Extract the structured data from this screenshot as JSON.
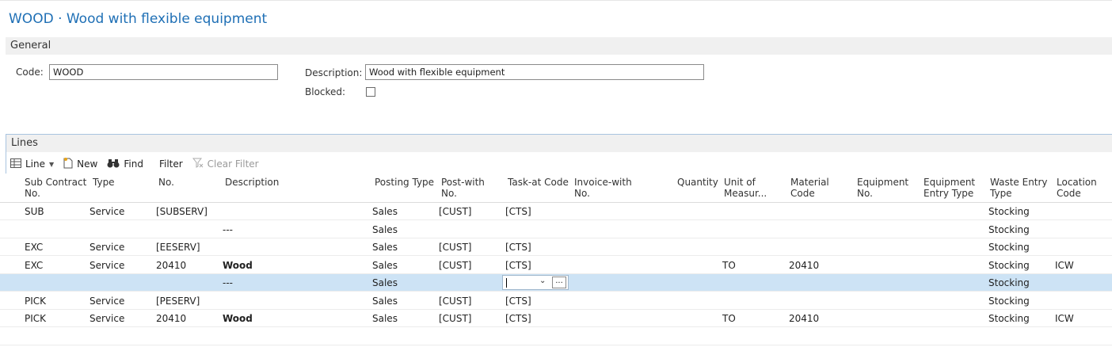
{
  "page": {
    "title": "WOOD · Wood with flexible equipment"
  },
  "general": {
    "section_label": "General",
    "code_label": "Code:",
    "code_value": "WOOD",
    "description_label": "Description:",
    "description_value": "Wood with flexible equipment",
    "blocked_label": "Blocked:",
    "blocked_checked": false
  },
  "lines": {
    "section_label": "Lines",
    "toolbar": {
      "line": "Line",
      "new": "New",
      "find": "Find",
      "filter": "Filter",
      "clear_filter": "Clear Filter"
    },
    "columns": [
      [
        "Sub Contract",
        "No."
      ],
      [
        "Type",
        ""
      ],
      [
        "No.",
        ""
      ],
      [
        "Description",
        ""
      ],
      [
        "Posting Type",
        ""
      ],
      [
        "Post-with",
        "No."
      ],
      [
        "Task-at Code",
        ""
      ],
      [
        "Invoice-with",
        "No."
      ],
      [
        "Quantity",
        ""
      ],
      [
        "Unit of",
        "Measur..."
      ],
      [
        "Material",
        "Code"
      ],
      [
        "Equipment",
        "No."
      ],
      [
        "Equipment",
        "Entry Type"
      ],
      [
        "Waste Entry",
        "Type"
      ],
      [
        "Location",
        "Code"
      ]
    ],
    "rows": [
      [
        "SUB",
        "Service",
        "[SUBSERV]",
        "",
        "Sales",
        "[CUST]",
        "[CTS]",
        "",
        "",
        "",
        "",
        "",
        "",
        "Stocking",
        ""
      ],
      [
        "",
        "",
        "",
        "---",
        "Sales",
        "",
        "",
        "",
        "",
        "",
        "",
        "",
        "",
        "Stocking",
        ""
      ],
      [
        "EXC",
        "Service",
        "[EESERV]",
        "",
        "Sales",
        "[CUST]",
        "[CTS]",
        "",
        "",
        "",
        "",
        "",
        "",
        "Stocking",
        ""
      ],
      [
        "EXC",
        "Service",
        "20410",
        "Wood",
        "Sales",
        "[CUST]",
        "[CTS]",
        "",
        "",
        "TO",
        "20410",
        "",
        "",
        "Stocking",
        "ICW"
      ],
      [
        "",
        "",
        "",
        "---",
        "Sales",
        "",
        "",
        "",
        "",
        "",
        "",
        "",
        "",
        "Stocking",
        ""
      ],
      [
        "PICK",
        "Service",
        "[PESERV]",
        "",
        "Sales",
        "[CUST]",
        "[CTS]",
        "",
        "",
        "",
        "",
        "",
        "",
        "Stocking",
        ""
      ],
      [
        "PICK",
        "Service",
        "20410",
        "Wood",
        "Sales",
        "[CUST]",
        "[CTS]",
        "",
        "",
        "TO",
        "20410",
        "",
        "",
        "Stocking",
        "ICW"
      ]
    ],
    "selected_row": 4,
    "bold_description_rows": [
      3,
      6
    ]
  },
  "icons": {
    "line": "grid-icon",
    "new": "new-document-icon",
    "find": "binoculars-icon",
    "clear_filter": "clear-filter-icon",
    "dropdown": "chevron-down-icon",
    "lookup": "ellipsis-icon"
  },
  "colors": {
    "title": "#1e6fb5",
    "section_bar": "#f0f0f0",
    "selected_row": "#cde3f5"
  }
}
